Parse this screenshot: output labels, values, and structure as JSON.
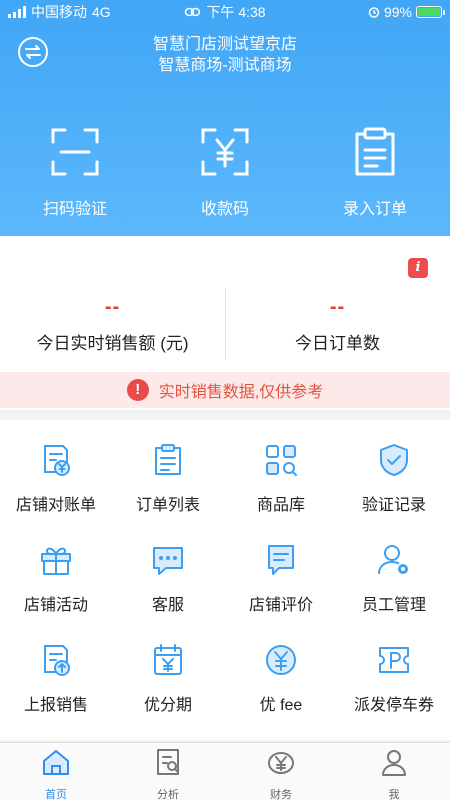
{
  "status_bar": {
    "carrier": "中国移动",
    "network": "4G",
    "time": "下午 4:38",
    "battery": "99%",
    "battery_level": 0.99
  },
  "header": {
    "store_name": "智慧门店测试望京店",
    "mall_name": "智慧商场-测试商场",
    "quick_actions": [
      {
        "label": "扫码验证",
        "icon": "scan-icon"
      },
      {
        "label": "收款码",
        "icon": "yuan-scan-icon"
      },
      {
        "label": "录入订单",
        "icon": "clipboard-icon"
      }
    ]
  },
  "sales": {
    "realtime_sales_value": "--",
    "realtime_sales_label": "今日实时销售额 (元)",
    "order_count_value": "--",
    "order_count_label": "今日订单数",
    "notice": "实时销售数据,仅供参考",
    "notice_icon": "!",
    "info_icon": "i"
  },
  "features": [
    {
      "label": "店铺对账单",
      "icon": "statement-icon"
    },
    {
      "label": "订单列表",
      "icon": "order-list-icon"
    },
    {
      "label": "商品库",
      "icon": "product-library-icon"
    },
    {
      "label": "验证记录",
      "icon": "shield-check-icon"
    },
    {
      "label": "店铺活动",
      "icon": "gift-icon"
    },
    {
      "label": "客服",
      "icon": "chat-icon"
    },
    {
      "label": "店铺评价",
      "icon": "review-icon"
    },
    {
      "label": "员工管理",
      "icon": "staff-icon"
    },
    {
      "label": "上报销售",
      "icon": "upload-sales-icon"
    },
    {
      "label": "优分期",
      "icon": "installment-icon"
    },
    {
      "label": "优 fee",
      "icon": "yuan-circle-icon"
    },
    {
      "label": "派发停车券",
      "icon": "parking-ticket-icon"
    }
  ],
  "tabs": [
    {
      "label": "首页",
      "icon": "home-icon",
      "active": true
    },
    {
      "label": "分析",
      "icon": "analysis-icon",
      "active": false
    },
    {
      "label": "财务",
      "icon": "finance-icon",
      "active": false
    },
    {
      "label": "我",
      "icon": "profile-icon",
      "active": false
    }
  ],
  "colors": {
    "header_blue": "#41a6f6",
    "icon_blue": "#3d9ff2",
    "alert_red": "#e8392e",
    "tab_active": "#2f8ef0"
  }
}
